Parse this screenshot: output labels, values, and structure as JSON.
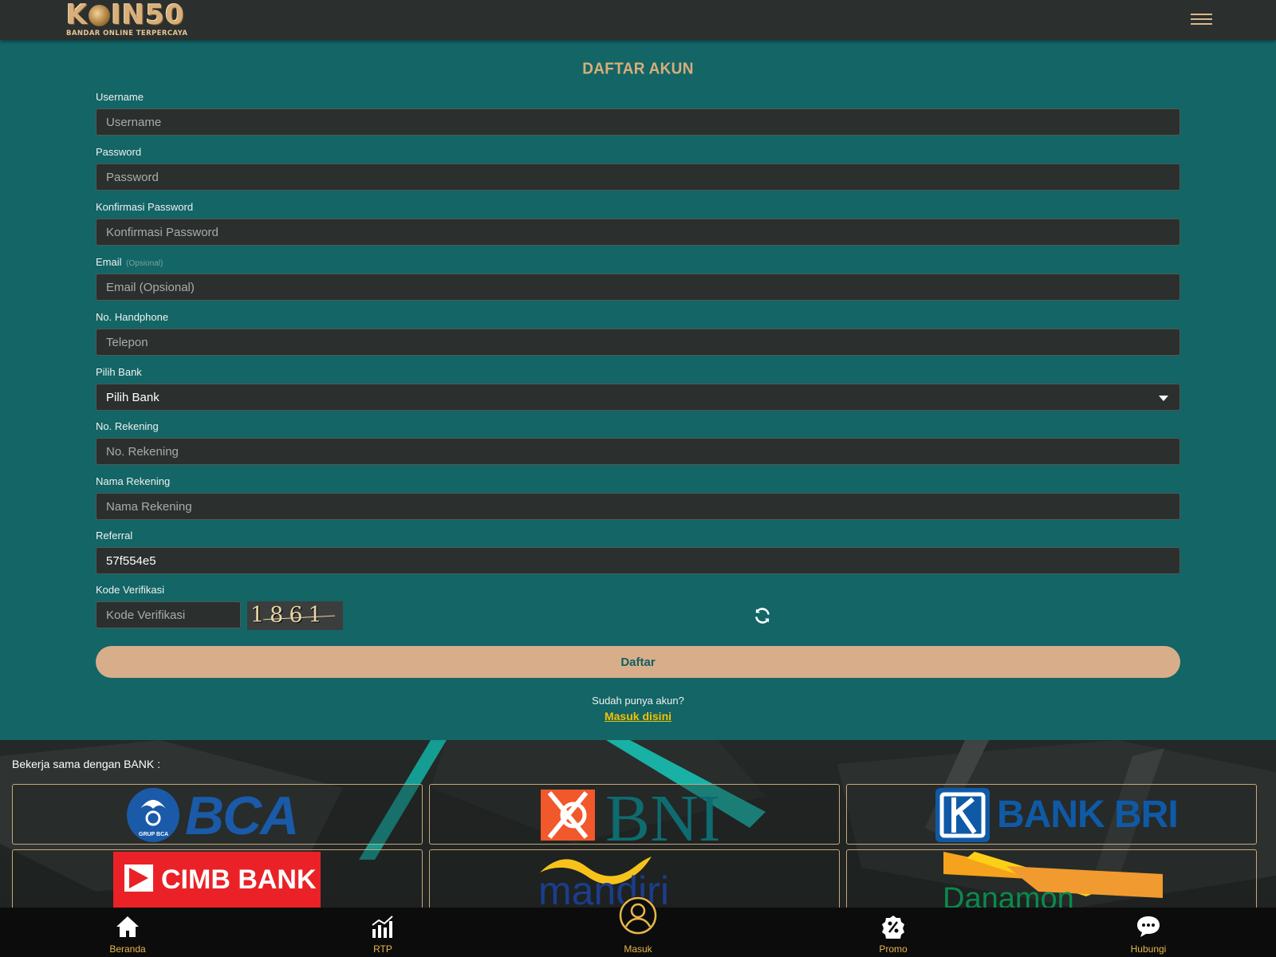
{
  "header": {
    "logo_main_a": "K",
    "logo_main_b": "IN50",
    "logo_sub": "BANDAR ONLINE TERPERCAYA"
  },
  "form": {
    "title": "DAFTAR AKUN",
    "fields": [
      {
        "label": "Username",
        "placeholder": "Username",
        "value": ""
      },
      {
        "label": "Password",
        "placeholder": "Password",
        "value": ""
      },
      {
        "label": "Konfirmasi Password",
        "placeholder": "Konfirmasi Password",
        "value": ""
      },
      {
        "label": "Email",
        "label_optional": "(Opsional)",
        "placeholder": "Email (Opsional)",
        "value": ""
      },
      {
        "label": "No. Handphone",
        "placeholder": "Telepon",
        "value": ""
      },
      {
        "label": "Pilih Bank",
        "selected": "Pilih Bank"
      },
      {
        "label": "No. Rekening",
        "placeholder": "No. Rekening",
        "value": ""
      },
      {
        "label": "Nama Rekening",
        "placeholder": "Nama Rekening",
        "value": ""
      },
      {
        "label": "Referral",
        "placeholder": "",
        "value": "57f554e5"
      },
      {
        "label": "Kode Verifikasi",
        "placeholder": "Kode Verifikasi",
        "value": ""
      }
    ],
    "captcha_text": "1861",
    "submit_label": "Daftar",
    "have_account": "Sudah punya akun?",
    "login_link": "Masuk disini"
  },
  "banks": {
    "title": "Bekerja sama dengan BANK :",
    "items": [
      "BCA",
      "BNI",
      "BANK BRI",
      "CIMB BANK",
      "mandiri",
      "Danamon"
    ],
    "bca_sub": "GRUP BCA"
  },
  "bottom_nav": {
    "items": [
      {
        "label": "Beranda",
        "icon": "home-icon"
      },
      {
        "label": "RTP",
        "icon": "chart-icon"
      },
      {
        "label": "Masuk",
        "icon": "user-icon"
      },
      {
        "label": "Promo",
        "icon": "percent-badge-icon"
      },
      {
        "label": "Hubungi",
        "icon": "chat-icon"
      }
    ]
  },
  "colors": {
    "page_bg": "#136566",
    "header_bg": "#2b2f2e",
    "input_bg": "#2b2f2e",
    "accent_gold": "#d8ae7a",
    "button_bg": "#d8ae8a",
    "link_yellow": "#f3c200",
    "nav_label": "#e7b64a",
    "nav_bg": "#0c0c0c"
  }
}
